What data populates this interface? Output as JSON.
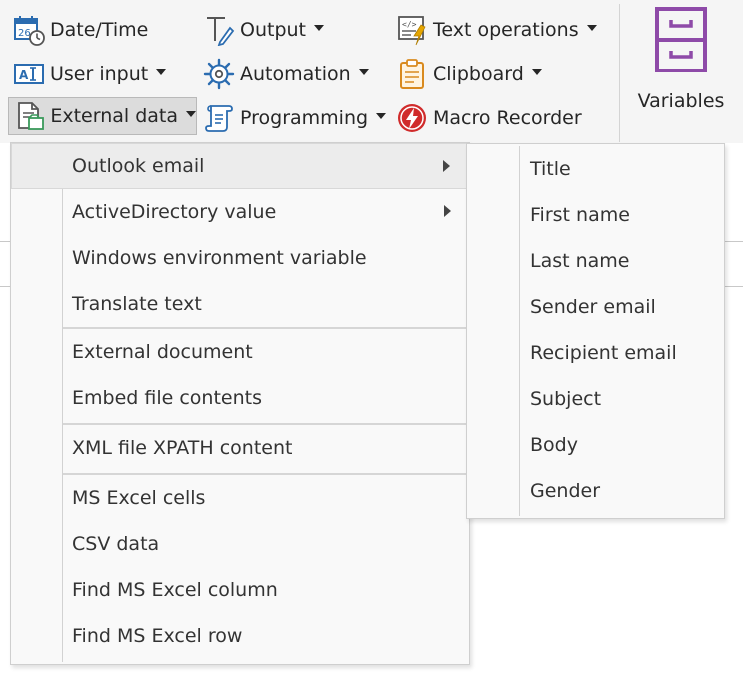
{
  "ribbon": {
    "buttons": {
      "datetime": "Date/Time",
      "user_input": "User input",
      "external_data": "External data",
      "output": "Output",
      "automation": "Automation",
      "programming": "Programming",
      "text_operations": "Text operations",
      "clipboard": "Clipboard",
      "macro_recorder": "Macro Recorder"
    },
    "variables": "Variables",
    "colors": {
      "accent_purple": "#8e4aa8",
      "blue": "#2b6cb0",
      "red": "#d02b2b"
    }
  },
  "external_data_menu": {
    "items": [
      {
        "label": "Outlook email",
        "submenu": true
      },
      {
        "label": "ActiveDirectory value",
        "submenu": true
      },
      {
        "label": "Windows environment variable",
        "submenu": false
      },
      {
        "label": "Translate text",
        "submenu": false
      },
      {
        "label": "External document",
        "submenu": false
      },
      {
        "label": "Embed file contents",
        "submenu": false
      },
      {
        "label": "XML file XPATH content",
        "submenu": false
      },
      {
        "label": "MS Excel cells",
        "submenu": false
      },
      {
        "label": "CSV data",
        "submenu": false
      },
      {
        "label": "Find MS Excel column",
        "submenu": false
      },
      {
        "label": "Find MS Excel row",
        "submenu": false
      }
    ]
  },
  "outlook_submenu": {
    "items": [
      {
        "label": "Title"
      },
      {
        "label": "First name"
      },
      {
        "label": "Last name"
      },
      {
        "label": "Sender email"
      },
      {
        "label": "Recipient email"
      },
      {
        "label": "Subject"
      },
      {
        "label": "Body"
      },
      {
        "label": "Gender"
      }
    ]
  }
}
